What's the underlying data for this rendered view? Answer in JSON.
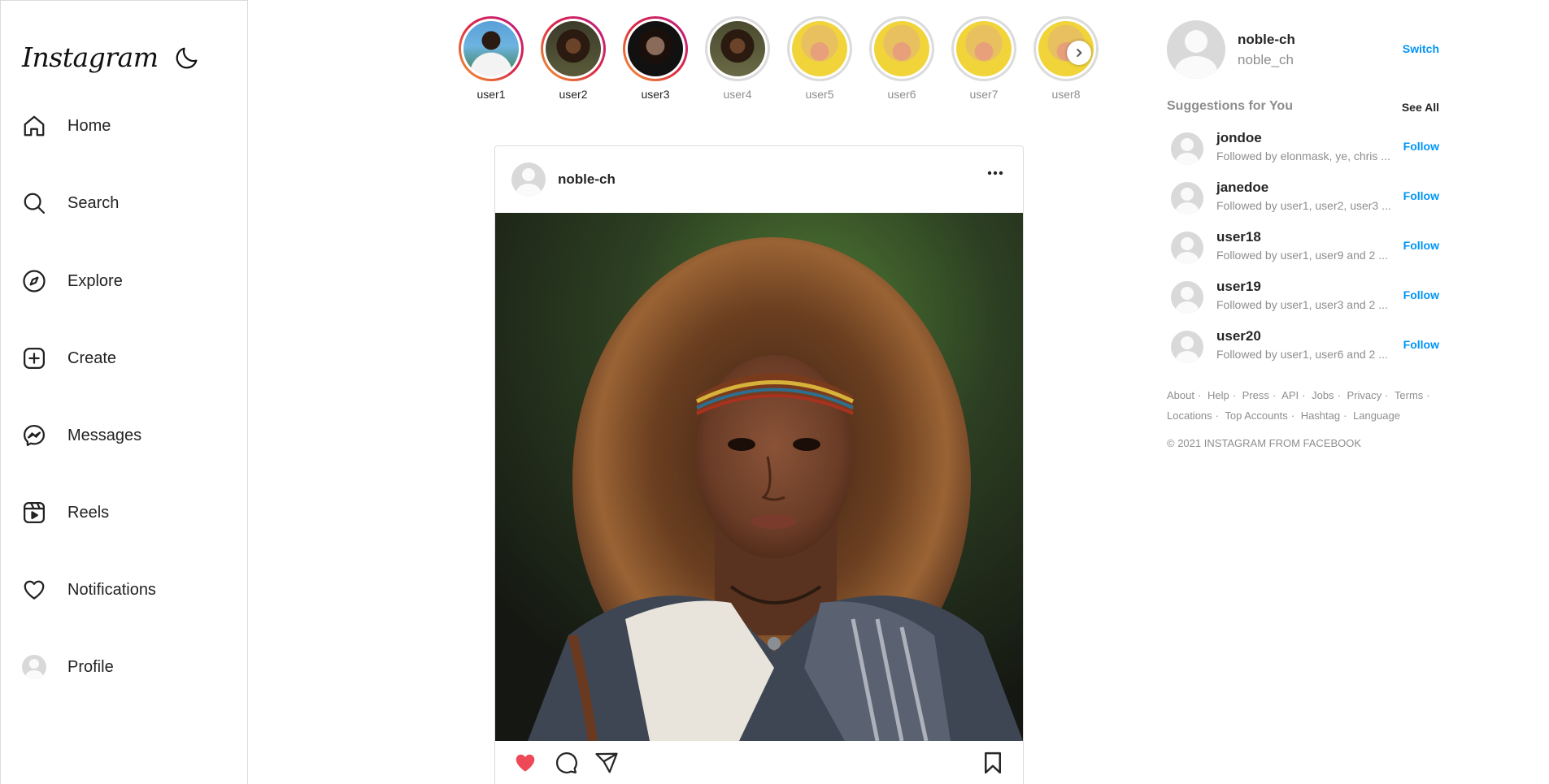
{
  "app": {
    "logo": "Instagram"
  },
  "sidebar": {
    "items": [
      {
        "label": "Home",
        "icon": "home-icon"
      },
      {
        "label": "Search",
        "icon": "search-icon"
      },
      {
        "label": "Explore",
        "icon": "compass-icon"
      },
      {
        "label": "Create",
        "icon": "plus-square-icon"
      },
      {
        "label": "Messages",
        "icon": "messenger-icon"
      },
      {
        "label": "Reels",
        "icon": "reels-icon"
      },
      {
        "label": "Notifications",
        "icon": "heart-icon"
      },
      {
        "label": "Profile",
        "icon": "avatar"
      }
    ]
  },
  "stories": [
    {
      "name": "user1",
      "seen": false
    },
    {
      "name": "user2",
      "seen": false
    },
    {
      "name": "user3",
      "seen": false
    },
    {
      "name": "user4",
      "seen": true
    },
    {
      "name": "user5",
      "seen": true
    },
    {
      "name": "user6",
      "seen": true
    },
    {
      "name": "user7",
      "seen": true
    },
    {
      "name": "user8",
      "seen": true
    }
  ],
  "post": {
    "username": "noble-ch",
    "liked": true,
    "like_color": "#ed4956"
  },
  "right": {
    "username": "noble-ch",
    "name": "noble_ch",
    "switch_label": "Switch",
    "suggestions_title": "Suggestions for You",
    "see_all": "See All",
    "follow_label": "Follow",
    "suggestions": [
      {
        "username": "jondoe",
        "sub": "Followed by elonmask, ye, chris ..."
      },
      {
        "username": "janedoe",
        "sub": "Followed by user1, user2, user3 ..."
      },
      {
        "username": "user18",
        "sub": "Followed by user1, user9 and 2 ..."
      },
      {
        "username": "user19",
        "sub": "Followed by user1, user3 and 2 ..."
      },
      {
        "username": "user20",
        "sub": "Followed by user1, user6 and 2 ..."
      }
    ],
    "footer_row1": [
      "About",
      "Help",
      "Press",
      "API",
      "Jobs",
      "Privacy",
      "Terms"
    ],
    "footer_row2": [
      "Locations",
      "Top Accounts",
      "Hashtag",
      "Language"
    ],
    "copyright": "© 2021 INSTAGRAM FROM FACEBOOK"
  },
  "colors": {
    "accent": "#0095f6",
    "border": "#dbdbdb",
    "muted": "#8e8e8e"
  }
}
